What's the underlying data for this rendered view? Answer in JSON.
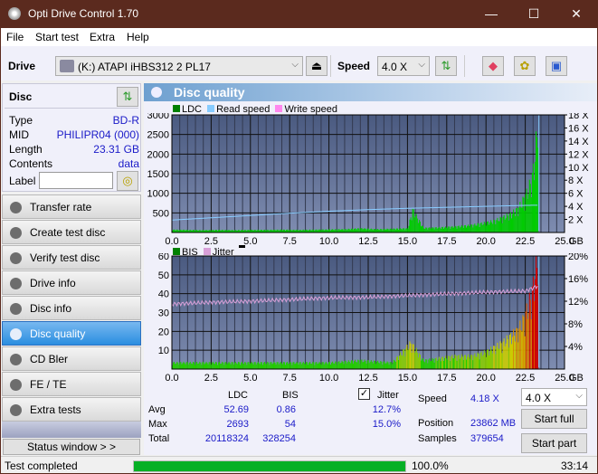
{
  "window": {
    "title": "Opti Drive Control 1.70",
    "minimize": "—",
    "maximize": "☐",
    "close": "✕"
  },
  "menu": [
    "File",
    "Start test",
    "Extra",
    "Help"
  ],
  "toolbar": {
    "drive_label": "Drive",
    "drive_value": "(K:)  ATAPI iHBS312   2 PL17",
    "speed_label": "Speed",
    "speed_value": "4.0 X",
    "chevron": "⌵",
    "eject": "⏏"
  },
  "disc": {
    "header": "Disc",
    "rows": [
      {
        "key": "Type",
        "value": "BD-R"
      },
      {
        "key": "MID",
        "value": "PHILIPR04 (000)"
      },
      {
        "key": "Length",
        "value": "23.31 GB"
      },
      {
        "key": "Contents",
        "value": "data"
      }
    ],
    "label_key": "Label",
    "label_value": ""
  },
  "nav": [
    {
      "label": "Transfer rate",
      "active": false
    },
    {
      "label": "Create test disc",
      "active": false
    },
    {
      "label": "Verify test disc",
      "active": false
    },
    {
      "label": "Drive info",
      "active": false
    },
    {
      "label": "Disc info",
      "active": false
    },
    {
      "label": "Disc quality",
      "active": true
    },
    {
      "label": "CD Bler",
      "active": false
    },
    {
      "label": "FE / TE",
      "active": false
    },
    {
      "label": "Extra tests",
      "active": false
    }
  ],
  "status_window_button": "Status window > >",
  "panel": {
    "title": "Disc quality"
  },
  "chart_data": [
    {
      "type": "bar",
      "title": "LDC / Read speed",
      "legend": [
        "LDC",
        "Read speed",
        "Write speed"
      ],
      "legend_colors": [
        "#008000",
        "#88ccff",
        "#ff88ee"
      ],
      "xlabel": "GB",
      "xlim": [
        0,
        25
      ],
      "x_ticks": [
        "0.0",
        "2.5",
        "5.0",
        "7.5",
        "10.0",
        "12.5",
        "15.0",
        "17.5",
        "20.0",
        "22.5",
        "25.0"
      ],
      "ylim": [
        0,
        3000
      ],
      "y_ticks": [
        "500",
        "1000",
        "1500",
        "2000",
        "2500",
        "3000"
      ],
      "y2lim": [
        0,
        18
      ],
      "y2_ticks": [
        "2 X",
        "4 X",
        "6 X",
        "8 X",
        "10 X",
        "12 X",
        "14 X",
        "16 X",
        "18 X"
      ],
      "ldc_series": {
        "x": [
          0,
          1,
          2,
          3,
          4,
          5,
          6,
          7,
          8,
          9,
          10,
          11,
          12,
          13,
          14,
          15,
          15.3,
          16,
          17,
          18,
          19,
          20,
          20.5,
          21,
          21.5,
          22,
          22.3,
          22.6,
          22.9,
          23.1,
          23.31
        ],
        "values": [
          60,
          55,
          50,
          55,
          50,
          55,
          55,
          60,
          55,
          60,
          65,
          70,
          90,
          70,
          80,
          90,
          500,
          100,
          110,
          130,
          160,
          220,
          260,
          330,
          400,
          520,
          700,
          900,
          1200,
          1700,
          2693
        ]
      },
      "read_speed_series": {
        "x": [
          0,
          2.5,
          5,
          7.5,
          10,
          12.5,
          15,
          17.5,
          20,
          22.5,
          23.31
        ],
        "values": [
          1.9,
          2.25,
          2.6,
          2.95,
          3.25,
          3.5,
          3.7,
          3.85,
          4.0,
          4.15,
          4.18
        ]
      }
    },
    {
      "type": "bar",
      "title": "BIS / Jitter",
      "legend": [
        "BIS",
        "Jitter"
      ],
      "legend_colors": [
        "#008000",
        "#d8a0d8"
      ],
      "xlabel": "GB",
      "xlim": [
        0,
        25
      ],
      "x_ticks": [
        "0.0",
        "2.5",
        "5.0",
        "7.5",
        "10.0",
        "12.5",
        "15.0",
        "17.5",
        "20.0",
        "22.5",
        "25.0"
      ],
      "ylim": [
        0,
        60
      ],
      "y_ticks": [
        "10",
        "20",
        "30",
        "40",
        "50",
        "60"
      ],
      "y2lim": [
        0,
        20
      ],
      "y2_ticks": [
        "4%",
        "8%",
        "12%",
        "16%",
        "20%"
      ],
      "bis_series": {
        "x": [
          0,
          2,
          4,
          6,
          8,
          10,
          12,
          14,
          15.2,
          16,
          17,
          18,
          19,
          20,
          20.5,
          21,
          21.5,
          22,
          22.3,
          22.6,
          22.9,
          23.1,
          23.31
        ],
        "values": [
          3,
          3,
          3,
          3,
          3,
          3,
          4,
          3,
          12,
          4,
          5,
          6,
          6,
          8,
          10,
          12,
          15,
          18,
          22,
          28,
          35,
          45,
          54
        ]
      },
      "jitter_series": {
        "x": [
          0,
          2.5,
          5,
          7.5,
          10,
          12.5,
          15,
          17.5,
          20,
          22.5,
          23.31
        ],
        "values": [
          11.5,
          11.8,
          12.0,
          12.3,
          12.6,
          12.7,
          13.0,
          13.3,
          13.6,
          13.8,
          14.7
        ]
      }
    }
  ],
  "stats": {
    "col_ldc": "LDC",
    "col_bis": "BIS",
    "jitter_label": "Jitter",
    "jitter_checked": true,
    "avg_label": "Avg",
    "max_label": "Max",
    "total_label": "Total",
    "ldc_avg": "52.69",
    "ldc_max": "2693",
    "ldc_total": "20118324",
    "bis_avg": "0.86",
    "bis_max": "54",
    "bis_total": "328254",
    "jitter_avg": "12.7%",
    "jitter_max": "15.0%",
    "speed_label": "Speed",
    "speed_value": "4.18 X",
    "position_label": "Position",
    "position_value": "23862 MB",
    "samples_label": "Samples",
    "samples_value": "379654",
    "speed_select": "4.0 X",
    "start_full": "Start full",
    "start_part": "Start part"
  },
  "statusbar": {
    "text": "Test completed",
    "progress": 100.0,
    "progress_text": "100.0%",
    "time": "33:14"
  }
}
